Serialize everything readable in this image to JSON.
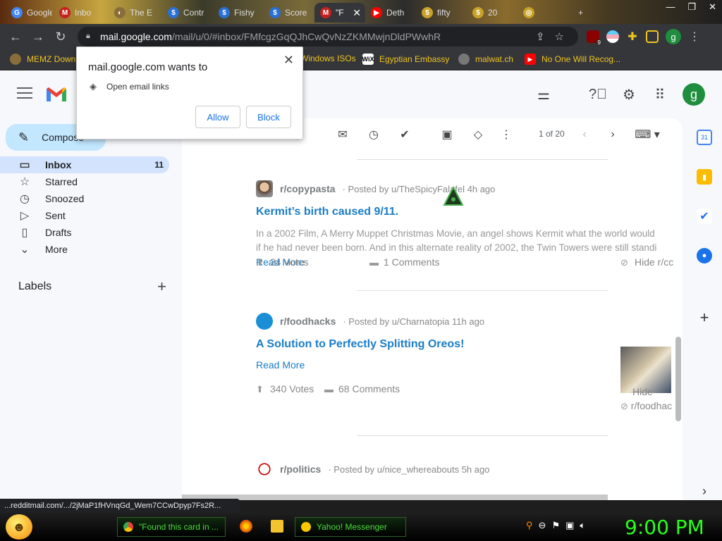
{
  "browser": {
    "tabs": [
      {
        "label": "Google",
        "fav_color": "#4285f4",
        "fav_text": "G"
      },
      {
        "label": "Inbo",
        "fav_color": "#c5221f",
        "fav_text": "M"
      },
      {
        "label": "The E",
        "fav_color": "#8a6d3b",
        "fav_text": "◐"
      },
      {
        "label": "Contr",
        "fav_color": "#2a6fd6",
        "fav_text": "$"
      },
      {
        "label": "Fishy",
        "fav_color": "#2a6fd6",
        "fav_text": "$"
      },
      {
        "label": "Score",
        "fav_color": "#2a6fd6",
        "fav_text": "$"
      },
      {
        "label": "\"F",
        "fav_color": "#c5221f",
        "fav_text": "M",
        "active": true
      },
      {
        "label": "Deth",
        "fav_color": "#ff0000",
        "fav_text": "▶"
      },
      {
        "label": "fifty",
        "fav_color": "#c9a227",
        "fav_text": "$"
      },
      {
        "label": "20",
        "fav_color": "#c9a227",
        "fav_text": "$"
      },
      {
        "label": "",
        "fav_color": "#c9a227",
        "fav_text": "◎"
      }
    ],
    "new_tab": "+",
    "url_host": "mail.google.com",
    "url_path": "/mail/u/0/#inbox/FMfcgzGqQJhCwQvNzZKMMwjnDldPWwhR",
    "profile_letter": "g",
    "ext_badge": "9",
    "bookmarks": [
      {
        "label": "MEMZ Down",
        "icon_color": "#8a6d3b"
      },
      {
        "label": "Windows ISOs",
        "icon_color": "#333"
      },
      {
        "label": "Egyptian Embassy",
        "icon_color": "#000",
        "icon_text": "WiX"
      },
      {
        "label": "malwat.ch",
        "icon_color": "#666"
      },
      {
        "label": "No One Will Recog...",
        "icon_color": "#ff0000",
        "icon_text": "▶"
      }
    ]
  },
  "gmail": {
    "compose": "Compose",
    "nav": [
      {
        "label": "Inbox",
        "count": "11",
        "icon": "inbox-icon",
        "glyph": "▭",
        "active": true
      },
      {
        "label": "Starred",
        "count": "",
        "icon": "star-icon",
        "glyph": "☆"
      },
      {
        "label": "Snoozed",
        "count": "",
        "icon": "clock-icon",
        "glyph": "◷"
      },
      {
        "label": "Sent",
        "count": "",
        "icon": "send-icon",
        "glyph": "▷"
      },
      {
        "label": "Drafts",
        "count": "",
        "icon": "draft-icon",
        "glyph": "▯"
      },
      {
        "label": "More",
        "count": "",
        "icon": "chevron-down-icon",
        "glyph": "⌄"
      }
    ],
    "labels_heading": "Labels",
    "pager": "1 of 20",
    "avatar_letter": "g"
  },
  "popup": {
    "title": "mail.google.com wants to",
    "permission": "Open email links",
    "allow": "Allow",
    "block": "Block"
  },
  "posts": [
    {
      "subreddit": "r/copypasta",
      "meta": "· Posted by u/TheSpicyFalafel 4h ago",
      "title": "Kermit’s birth caused 9/11.",
      "line1": "In a 2002 Film, A Merry Muppet Christmas Movie, an angel shows Kermit what the world would",
      "line2": "if he had never been born. And in this alternate reality of 2002, the Twin Towers were still standi",
      "read_more": "Read More",
      "votes": "24 Votes",
      "comments": "1 Comments",
      "hide": "Hide r/cc"
    },
    {
      "subreddit": "r/foodhacks",
      "meta": "· Posted by u/Charnatopia 11h ago",
      "title": "A Solution to Perfectly Splitting Oreos!",
      "read_more": "Read More",
      "votes": "340 Votes",
      "comments": "68 Comments",
      "hide1": "Hide",
      "hide2": "r/foodhac"
    },
    {
      "subreddit": "r/politics",
      "meta": "· Posted by u/nice_whereabouts 5h ago"
    }
  ],
  "status_url": "...redditmail.com/.../2jMaP1fHVnqGd_Wem7CCwDpyp7Fs2R...",
  "taskbar": {
    "task1": "\"Found this card in ...",
    "task2": "Yahoo! Messenger",
    "clock": "9:00 PM"
  }
}
